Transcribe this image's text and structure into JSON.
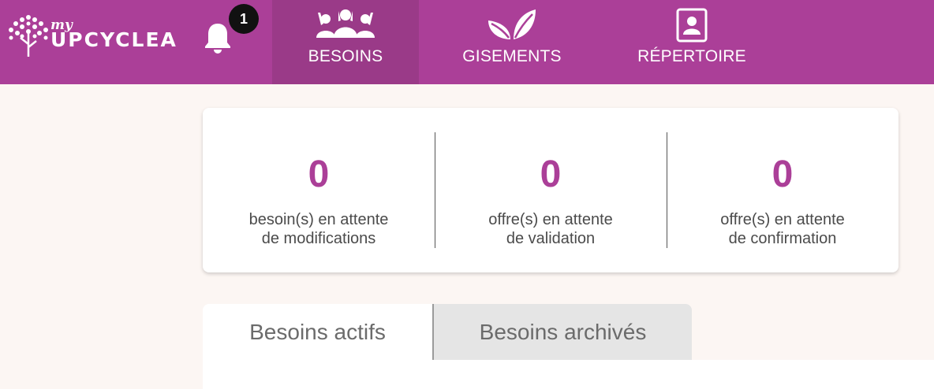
{
  "header": {
    "logo": {
      "my": "my",
      "word": "UPCYCLEA"
    },
    "notifications": {
      "icon": "bell-icon",
      "count": "1"
    },
    "nav": [
      {
        "label": "BESOINS",
        "icon": "people-icon",
        "active": true
      },
      {
        "label": "GISEMENTS",
        "icon": "leaves-icon",
        "active": false
      },
      {
        "label": "RÉPERTOIRE",
        "icon": "contact-book-icon",
        "active": false
      }
    ],
    "colors": {
      "brand": "#ab3f98",
      "active_nav": "#9a3a88"
    }
  },
  "stats": [
    {
      "value": "0",
      "line1": "besoin(s) en attente",
      "line2": "de modifications"
    },
    {
      "value": "0",
      "line1": "offre(s) en attente",
      "line2": "de validation"
    },
    {
      "value": "0",
      "line1": "offre(s) en attente",
      "line2": "de confirmation"
    }
  ],
  "tabs": [
    {
      "label": "Besoins actifs",
      "active": true
    },
    {
      "label": "Besoins archivés",
      "active": false
    }
  ]
}
